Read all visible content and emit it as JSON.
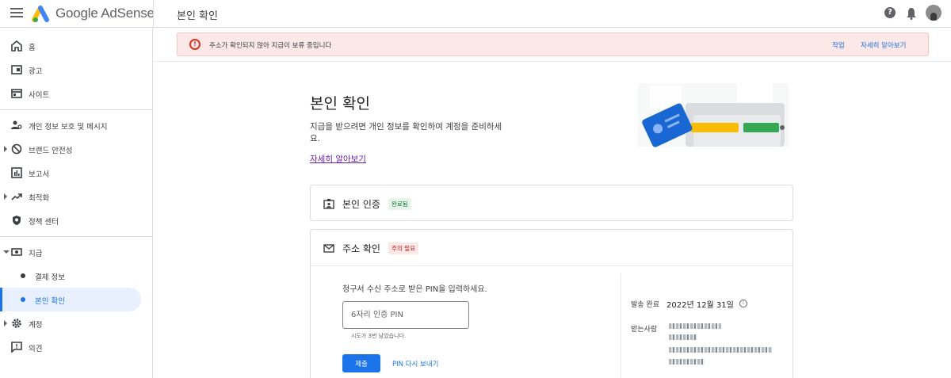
{
  "header": {
    "brand": "Google AdSense",
    "page_title": "본인 확인",
    "help_glyph": "?"
  },
  "sidebar": {
    "items": [
      {
        "label": "홈",
        "icon": "home-icon"
      },
      {
        "label": "광고",
        "icon": "ads-icon"
      },
      {
        "label": "사이트",
        "icon": "sites-icon"
      },
      {
        "label": "개인 정보 보호 및 메시지",
        "icon": "privacy-icon"
      },
      {
        "label": "브랜드 안전성",
        "icon": "block-icon"
      },
      {
        "label": "보고서",
        "icon": "reports-icon"
      },
      {
        "label": "최적화",
        "icon": "trending-icon"
      },
      {
        "label": "정책 센터",
        "icon": "shield-icon"
      },
      {
        "label": "지급",
        "icon": "payments-icon"
      },
      {
        "label": "결제 정보",
        "icon": "dot"
      },
      {
        "label": "본인 확인",
        "icon": "dot"
      },
      {
        "label": "계정",
        "icon": "gear-icon"
      },
      {
        "label": "의견",
        "icon": "feedback-icon"
      }
    ]
  },
  "alert": {
    "message": "주소가 확인되지 않아 지급이 보류 중입니다",
    "action": "작업",
    "learn_more": "자세히 알아보기",
    "glyph": "!"
  },
  "main": {
    "title": "본인 확인",
    "description": "지급을 받으려면 개인 정보를 확인하여 계정을 준비하세요.",
    "learn_more": "자세히 알아보기",
    "identity_card": {
      "title": "본인 인증",
      "badge": "완료됨"
    },
    "address_card": {
      "title": "주소 확인",
      "badge": "주의 필요",
      "pin_prompt": "청구서 수신 주소로 받은 PIN을 입력하세요.",
      "pin_placeholder": "6자리 인증 PIN",
      "pin_hint": "시도가 3번 남았습니다.",
      "submit_label": "제출",
      "resend_label": "PIN 다시 보내기",
      "sent_label": "발송 완료",
      "sent_date": "2022년 12월 31일",
      "info_glyph": "i",
      "recipient_label": "받는사람"
    }
  },
  "colors": {
    "accent": "#1a73e8",
    "alert_bg": "#fce8e6",
    "ok": "#137333",
    "warn": "#c5221f"
  }
}
